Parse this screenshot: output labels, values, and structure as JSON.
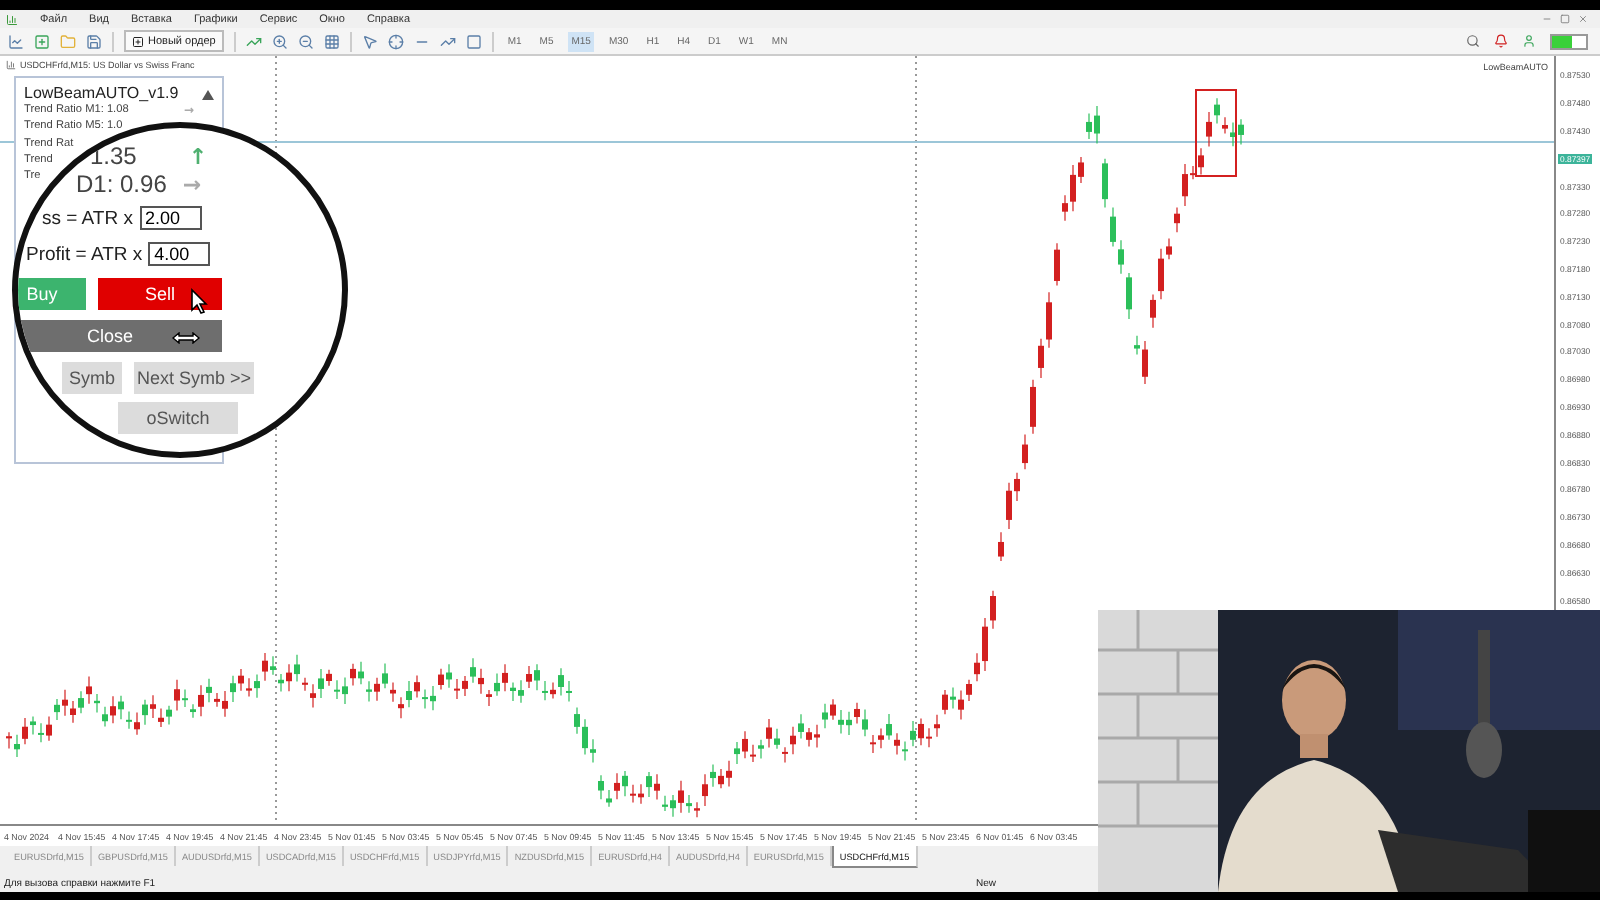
{
  "menu_bar": {
    "items": [
      "Файл",
      "Вид",
      "Вставка",
      "Графики",
      "Сервис",
      "Окно",
      "Справка"
    ]
  },
  "toolbar": {
    "new_order": "Новый ордер",
    "timeframes": [
      {
        "label": "M1",
        "selected": false
      },
      {
        "label": "M5",
        "selected": false
      },
      {
        "label": "M15",
        "selected": true
      },
      {
        "label": "M30",
        "selected": false
      },
      {
        "label": "H1",
        "selected": false
      },
      {
        "label": "H4",
        "selected": false
      },
      {
        "label": "D1",
        "selected": false
      },
      {
        "label": "W1",
        "selected": false
      },
      {
        "label": "MN",
        "selected": false
      }
    ]
  },
  "chart": {
    "title": "USDCHFrfd,M15:  US Dollar vs Swiss Franc",
    "expert_label": "LowBeamAUTO",
    "price_labels": [
      {
        "text": "0.87530",
        "current": false
      },
      {
        "text": "0.87480",
        "current": false
      },
      {
        "text": "0.87430",
        "current": false
      },
      {
        "text": "0.87397",
        "current": true
      },
      {
        "text": "0.87330",
        "current": false
      },
      {
        "text": "0.87280",
        "current": false
      },
      {
        "text": "0.87230",
        "current": false
      },
      {
        "text": "0.87180",
        "current": false
      },
      {
        "text": "0.87130",
        "current": false
      },
      {
        "text": "0.87080",
        "current": false
      },
      {
        "text": "0.87030",
        "current": false
      },
      {
        "text": "0.86980",
        "current": false
      },
      {
        "text": "0.86930",
        "current": false
      },
      {
        "text": "0.86880",
        "current": false
      },
      {
        "text": "0.86830",
        "current": false
      },
      {
        "text": "0.86780",
        "current": false
      },
      {
        "text": "0.86730",
        "current": false
      },
      {
        "text": "0.86680",
        "current": false
      },
      {
        "text": "0.86630",
        "current": false
      },
      {
        "text": "0.86580",
        "current": false
      }
    ],
    "time_labels": [
      "4 Nov 2024",
      "4 Nov 15:45",
      "4 Nov 17:45",
      "4 Nov 19:45",
      "4 Nov 21:45",
      "4 Nov 23:45",
      "5 Nov 01:45",
      "5 Nov 03:45",
      "5 Nov 05:45",
      "5 Nov 07:45",
      "5 Nov 09:45",
      "5 Nov 11:45",
      "5 Nov 13:45",
      "5 Nov 15:45",
      "5 Nov 17:45",
      "5 Nov 19:45",
      "5 Nov 21:45",
      "5 Nov 23:45",
      "6 Nov 01:45",
      "6 Nov 03:45"
    ]
  },
  "panel": {
    "title": "LowBeamAUTO_v1.9",
    "lines": [
      {
        "text": "Trend Ratio M1: 1.08",
        "arrow": "→"
      },
      {
        "text": "Trend Ratio M5: 1.0"
      },
      {
        "text": "Trend Rat"
      },
      {
        "text": "Trend"
      },
      {
        "text": "Tre"
      }
    ]
  },
  "magnifier": {
    "trend_rows": [
      {
        "text": "1.35",
        "arrow": "↑",
        "color": "#4fb070"
      },
      {
        "text": "D1: 0.96",
        "arrow": "→",
        "color": "#aaaaaa"
      }
    ],
    "fields": [
      {
        "label": "ss  = ATR x",
        "value": "2.00"
      },
      {
        "label": "Profit = ATR x",
        "value": "4.00"
      }
    ],
    "buttons": [
      {
        "label": "Buy",
        "kind": "buy"
      },
      {
        "label": "Sell",
        "kind": "sell"
      },
      {
        "label": "Close",
        "kind": "close"
      },
      {
        "label": "Symb",
        "kind": "plain"
      },
      {
        "label": "Next Symb >>",
        "kind": "plain"
      },
      {
        "label": "oSwitch",
        "kind": "plain"
      }
    ]
  },
  "symbol_tabs": [
    {
      "label": "EURUSDrfd,M15",
      "selected": false
    },
    {
      "label": "GBPUSDrfd,M15",
      "selected": false
    },
    {
      "label": "AUDUSDrfd,M15",
      "selected": false
    },
    {
      "label": "USDCADrfd,M15",
      "selected": false
    },
    {
      "label": "USDCHFrfd,M15",
      "selected": false
    },
    {
      "label": "USDJPYrfd,M15",
      "selected": false
    },
    {
      "label": "NZDUSDrfd,M15",
      "selected": false
    },
    {
      "label": "EURUSDrfd,H4",
      "selected": false
    },
    {
      "label": "AUDUSDrfd,H4",
      "selected": false
    },
    {
      "label": "EURUSDrfd,M15",
      "selected": false
    },
    {
      "label": "USDCHFrfd,M15",
      "selected": true
    }
  ],
  "status_bar": {
    "hint": "Для вызова справки нажмите F1",
    "profile": "New"
  }
}
